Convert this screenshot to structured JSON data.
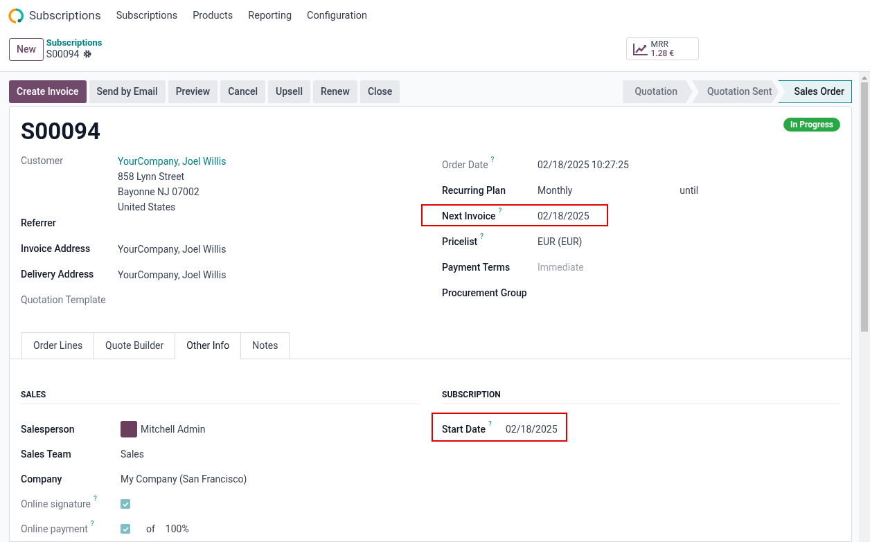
{
  "navbar": {
    "app_name": "Subscriptions",
    "menu": [
      "Subscriptions",
      "Products",
      "Reporting",
      "Configuration"
    ]
  },
  "control_panel": {
    "new_button": "New",
    "breadcrumb": "Subscriptions",
    "record": "S00094",
    "mrr_label": "MRR",
    "mrr_value": "1.28 €"
  },
  "actions": [
    {
      "label": "Create Invoice",
      "primary": true
    },
    {
      "label": "Send by Email",
      "primary": false
    },
    {
      "label": "Preview",
      "primary": false
    },
    {
      "label": "Cancel",
      "primary": false
    },
    {
      "label": "Upsell",
      "primary": false
    },
    {
      "label": "Renew",
      "primary": false
    },
    {
      "label": "Close",
      "primary": false
    }
  ],
  "stages": [
    {
      "label": "Quotation",
      "selected": false
    },
    {
      "label": "Quotation Sent",
      "selected": false
    },
    {
      "label": "Sales Order",
      "selected": true
    }
  ],
  "form": {
    "title": "S00094",
    "ribbon": "In Progress",
    "left_fields": [
      {
        "label": "Customer",
        "strong": false,
        "values": [
          "YourCompany, Joel Willis",
          "858 Lynn Street",
          "Bayonne NJ 07002",
          "United States"
        ],
        "link": true
      },
      {
        "label": "Referrer",
        "strong": true
      },
      {
        "label": "Invoice Address",
        "strong": true,
        "values": [
          "YourCompany, Joel Willis"
        ],
        "link": false
      },
      {
        "label": "Delivery Address",
        "strong": true,
        "values": [
          "YourCompany, Joel Willis"
        ],
        "link": false
      },
      {
        "label": "Quotation Template",
        "strong": false
      }
    ],
    "right_fields": [
      {
        "label": "Order Date",
        "strong": false,
        "help": "?",
        "value": "02/18/2025 10:27:25",
        "highlighted": false
      },
      {
        "label": "Recurring Plan",
        "strong": true,
        "value": "Monthly",
        "extra": "until",
        "highlighted": false
      },
      {
        "label": "Next Invoice",
        "strong": true,
        "help": "?",
        "value": "02/18/2025",
        "highlighted": true
      },
      {
        "label": "Pricelist",
        "strong": true,
        "help": "?",
        "value": "EUR (EUR)",
        "highlighted": false
      },
      {
        "label": "Payment Terms",
        "strong": true,
        "placeholder": "Immediate",
        "highlighted": false
      },
      {
        "label": "Procurement Group",
        "strong": true,
        "highlighted": false
      }
    ],
    "tabs": [
      {
        "label": "Order Lines",
        "selected": false
      },
      {
        "label": "Quote Builder",
        "selected": false
      },
      {
        "label": "Other Info",
        "selected": true
      },
      {
        "label": "Notes",
        "selected": false
      }
    ],
    "sales": {
      "heading": "SALES",
      "fields": [
        {
          "kind": "avatar",
          "label": "Salesperson",
          "strong": true,
          "value": "Mitchell Admin"
        },
        {
          "kind": "text",
          "label": "Sales Team",
          "strong": true,
          "value": "Sales"
        },
        {
          "kind": "text",
          "label": "Company",
          "strong": true,
          "value": "My Company (San Francisco)"
        },
        {
          "kind": "checkbox",
          "label": "Online signature",
          "strong": false,
          "help": "?",
          "checked": true
        },
        {
          "kind": "checkbox",
          "label": "Online payment",
          "strong": false,
          "help": "?",
          "checked": true,
          "of": "of",
          "percent": "100%"
        }
      ]
    },
    "subscription": {
      "heading": "SUBSCRIPTION",
      "fields": [
        {
          "label": "Start Date",
          "strong": true,
          "help": "?",
          "value": "02/18/2025",
          "highlighted": true
        }
      ]
    }
  }
}
